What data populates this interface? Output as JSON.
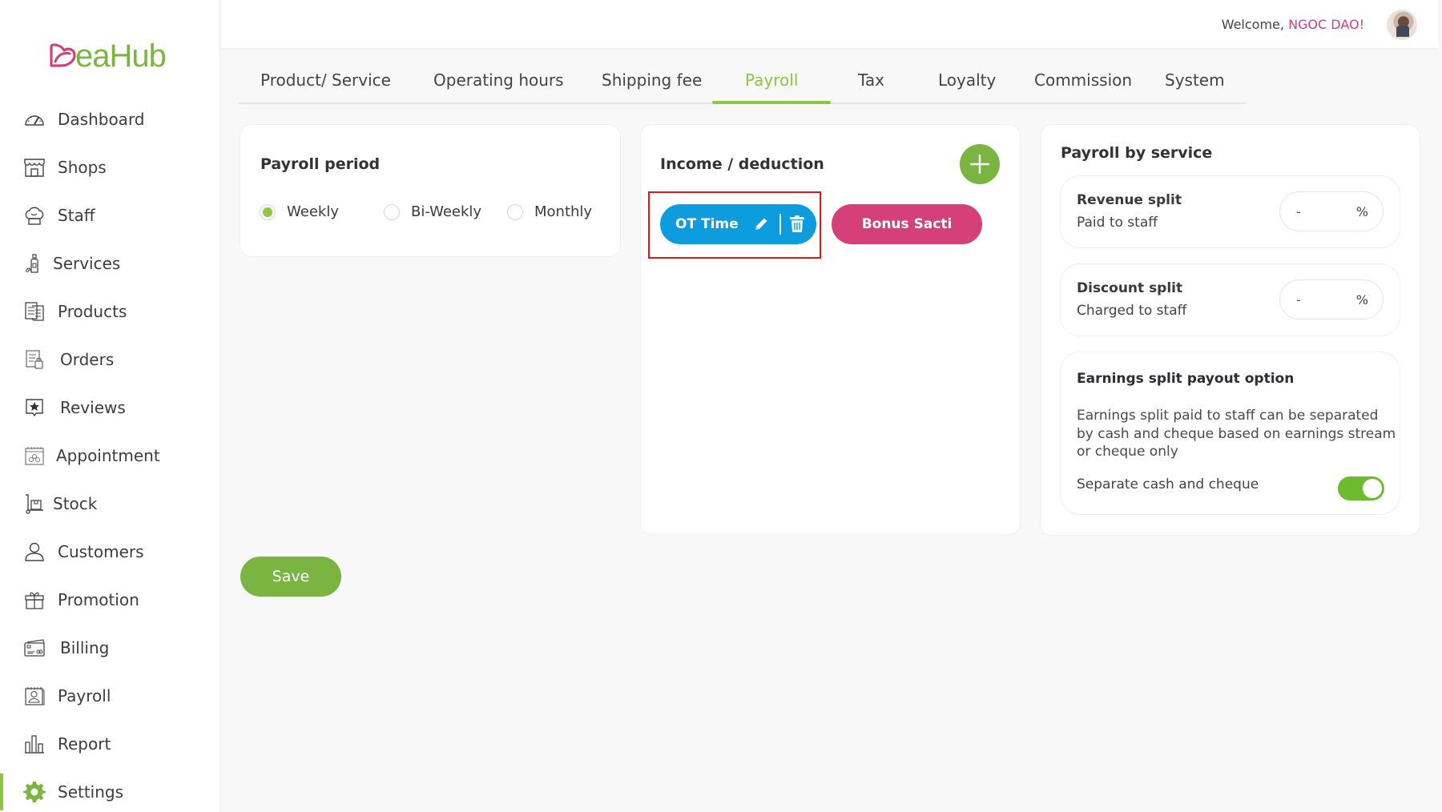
{
  "brand": {
    "name": "eaHub",
    "heart_color": "#d6407a",
    "word_color": "#7ab542"
  },
  "header": {
    "welcome_prefix": "Welcome, ",
    "user_name": "NGOC DAO!"
  },
  "sidebar": {
    "items": [
      {
        "label": "Dashboard",
        "icon": "gauge-icon"
      },
      {
        "label": "Shops",
        "icon": "storefront-icon"
      },
      {
        "label": "Staff",
        "icon": "chef-hat-icon"
      },
      {
        "label": "Services",
        "icon": "spa-bottle-icon"
      },
      {
        "label": "Products",
        "icon": "document-list-icon"
      },
      {
        "label": "Orders",
        "icon": "order-bag-icon"
      },
      {
        "label": "Reviews",
        "icon": "star-review-icon"
      },
      {
        "label": "Appointment",
        "icon": "calendar-flower-icon"
      },
      {
        "label": "Stock",
        "icon": "hand-truck-icon"
      },
      {
        "label": "Customers",
        "icon": "user-icon"
      },
      {
        "label": "Promotion",
        "icon": "gift-icon"
      },
      {
        "label": "Billing",
        "icon": "credit-card-icon"
      },
      {
        "label": "Payroll",
        "icon": "payroll-calendar-icon"
      },
      {
        "label": "Report",
        "icon": "bar-chart-icon"
      },
      {
        "label": "Settings",
        "icon": "gear-icon",
        "active": true
      }
    ]
  },
  "tabs": [
    {
      "label": "Product/ Service"
    },
    {
      "label": "Operating hours"
    },
    {
      "label": "Shipping fee"
    },
    {
      "label": "Payroll",
      "active": true
    },
    {
      "label": "Tax"
    },
    {
      "label": "Loyalty"
    },
    {
      "label": "Commission"
    },
    {
      "label": "System"
    }
  ],
  "payroll_period": {
    "title": "Payroll period",
    "options": [
      {
        "label": "Weekly",
        "checked": true
      },
      {
        "label": "Bi-Weekly",
        "checked": false
      },
      {
        "label": "Monthly",
        "checked": false
      }
    ]
  },
  "income_deduction": {
    "title": "Income / deduction",
    "add_icon": "plus-icon",
    "items": [
      {
        "label": "OT Time",
        "color": "#0d9ddf",
        "selected": true
      },
      {
        "label": "Bonus Sacti",
        "color": "#d6407a"
      }
    ]
  },
  "payroll_by_service": {
    "title": "Payroll by service",
    "revenue": {
      "title": "Revenue split",
      "subtitle": "Paid to staff",
      "value": "-",
      "unit": "%"
    },
    "discount": {
      "title": "Discount split",
      "subtitle": "Charged to staff",
      "value": "-",
      "unit": "%"
    },
    "earnings": {
      "title": "Earnings split payout option",
      "description_lines": [
        "Earnings split paid to staff can be separated",
        "by cash and cheque based on earnings stream",
        "or cheque only"
      ],
      "toggle_label": "Separate cash and cheque",
      "toggle_on": true
    }
  },
  "actions": {
    "save_label": "Save"
  },
  "colors": {
    "accent_green": "#8dc63f",
    "button_green": "#7ab542",
    "brand_pink": "#d6407a",
    "chip_blue": "#0d9ddf",
    "highlight_red": "#e0181b"
  }
}
